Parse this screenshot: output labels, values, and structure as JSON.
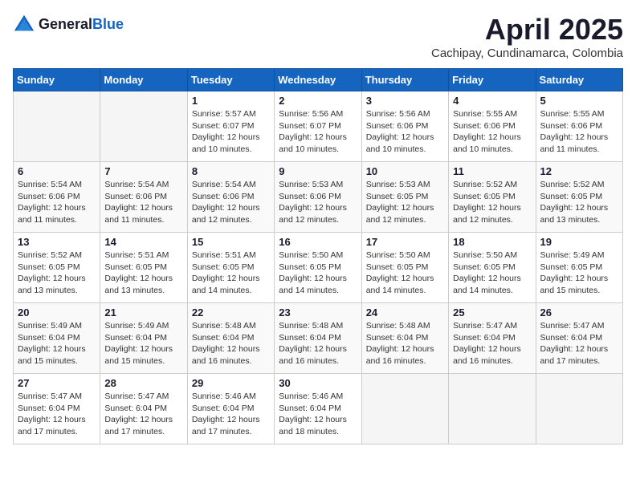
{
  "header": {
    "logo_general": "General",
    "logo_blue": "Blue",
    "month_year": "April 2025",
    "location": "Cachipay, Cundinamarca, Colombia"
  },
  "calendar": {
    "weekdays": [
      "Sunday",
      "Monday",
      "Tuesday",
      "Wednesday",
      "Thursday",
      "Friday",
      "Saturday"
    ],
    "weeks": [
      [
        {
          "day": "",
          "sunrise": "",
          "sunset": "",
          "daylight": ""
        },
        {
          "day": "",
          "sunrise": "",
          "sunset": "",
          "daylight": ""
        },
        {
          "day": "1",
          "sunrise": "Sunrise: 5:57 AM",
          "sunset": "Sunset: 6:07 PM",
          "daylight": "Daylight: 12 hours and 10 minutes."
        },
        {
          "day": "2",
          "sunrise": "Sunrise: 5:56 AM",
          "sunset": "Sunset: 6:07 PM",
          "daylight": "Daylight: 12 hours and 10 minutes."
        },
        {
          "day": "3",
          "sunrise": "Sunrise: 5:56 AM",
          "sunset": "Sunset: 6:06 PM",
          "daylight": "Daylight: 12 hours and 10 minutes."
        },
        {
          "day": "4",
          "sunrise": "Sunrise: 5:55 AM",
          "sunset": "Sunset: 6:06 PM",
          "daylight": "Daylight: 12 hours and 10 minutes."
        },
        {
          "day": "5",
          "sunrise": "Sunrise: 5:55 AM",
          "sunset": "Sunset: 6:06 PM",
          "daylight": "Daylight: 12 hours and 11 minutes."
        }
      ],
      [
        {
          "day": "6",
          "sunrise": "Sunrise: 5:54 AM",
          "sunset": "Sunset: 6:06 PM",
          "daylight": "Daylight: 12 hours and 11 minutes."
        },
        {
          "day": "7",
          "sunrise": "Sunrise: 5:54 AM",
          "sunset": "Sunset: 6:06 PM",
          "daylight": "Daylight: 12 hours and 11 minutes."
        },
        {
          "day": "8",
          "sunrise": "Sunrise: 5:54 AM",
          "sunset": "Sunset: 6:06 PM",
          "daylight": "Daylight: 12 hours and 12 minutes."
        },
        {
          "day": "9",
          "sunrise": "Sunrise: 5:53 AM",
          "sunset": "Sunset: 6:06 PM",
          "daylight": "Daylight: 12 hours and 12 minutes."
        },
        {
          "day": "10",
          "sunrise": "Sunrise: 5:53 AM",
          "sunset": "Sunset: 6:05 PM",
          "daylight": "Daylight: 12 hours and 12 minutes."
        },
        {
          "day": "11",
          "sunrise": "Sunrise: 5:52 AM",
          "sunset": "Sunset: 6:05 PM",
          "daylight": "Daylight: 12 hours and 12 minutes."
        },
        {
          "day": "12",
          "sunrise": "Sunrise: 5:52 AM",
          "sunset": "Sunset: 6:05 PM",
          "daylight": "Daylight: 12 hours and 13 minutes."
        }
      ],
      [
        {
          "day": "13",
          "sunrise": "Sunrise: 5:52 AM",
          "sunset": "Sunset: 6:05 PM",
          "daylight": "Daylight: 12 hours and 13 minutes."
        },
        {
          "day": "14",
          "sunrise": "Sunrise: 5:51 AM",
          "sunset": "Sunset: 6:05 PM",
          "daylight": "Daylight: 12 hours and 13 minutes."
        },
        {
          "day": "15",
          "sunrise": "Sunrise: 5:51 AM",
          "sunset": "Sunset: 6:05 PM",
          "daylight": "Daylight: 12 hours and 14 minutes."
        },
        {
          "day": "16",
          "sunrise": "Sunrise: 5:50 AM",
          "sunset": "Sunset: 6:05 PM",
          "daylight": "Daylight: 12 hours and 14 minutes."
        },
        {
          "day": "17",
          "sunrise": "Sunrise: 5:50 AM",
          "sunset": "Sunset: 6:05 PM",
          "daylight": "Daylight: 12 hours and 14 minutes."
        },
        {
          "day": "18",
          "sunrise": "Sunrise: 5:50 AM",
          "sunset": "Sunset: 6:05 PM",
          "daylight": "Daylight: 12 hours and 14 minutes."
        },
        {
          "day": "19",
          "sunrise": "Sunrise: 5:49 AM",
          "sunset": "Sunset: 6:05 PM",
          "daylight": "Daylight: 12 hours and 15 minutes."
        }
      ],
      [
        {
          "day": "20",
          "sunrise": "Sunrise: 5:49 AM",
          "sunset": "Sunset: 6:04 PM",
          "daylight": "Daylight: 12 hours and 15 minutes."
        },
        {
          "day": "21",
          "sunrise": "Sunrise: 5:49 AM",
          "sunset": "Sunset: 6:04 PM",
          "daylight": "Daylight: 12 hours and 15 minutes."
        },
        {
          "day": "22",
          "sunrise": "Sunrise: 5:48 AM",
          "sunset": "Sunset: 6:04 PM",
          "daylight": "Daylight: 12 hours and 16 minutes."
        },
        {
          "day": "23",
          "sunrise": "Sunrise: 5:48 AM",
          "sunset": "Sunset: 6:04 PM",
          "daylight": "Daylight: 12 hours and 16 minutes."
        },
        {
          "day": "24",
          "sunrise": "Sunrise: 5:48 AM",
          "sunset": "Sunset: 6:04 PM",
          "daylight": "Daylight: 12 hours and 16 minutes."
        },
        {
          "day": "25",
          "sunrise": "Sunrise: 5:47 AM",
          "sunset": "Sunset: 6:04 PM",
          "daylight": "Daylight: 12 hours and 16 minutes."
        },
        {
          "day": "26",
          "sunrise": "Sunrise: 5:47 AM",
          "sunset": "Sunset: 6:04 PM",
          "daylight": "Daylight: 12 hours and 17 minutes."
        }
      ],
      [
        {
          "day": "27",
          "sunrise": "Sunrise: 5:47 AM",
          "sunset": "Sunset: 6:04 PM",
          "daylight": "Daylight: 12 hours and 17 minutes."
        },
        {
          "day": "28",
          "sunrise": "Sunrise: 5:47 AM",
          "sunset": "Sunset: 6:04 PM",
          "daylight": "Daylight: 12 hours and 17 minutes."
        },
        {
          "day": "29",
          "sunrise": "Sunrise: 5:46 AM",
          "sunset": "Sunset: 6:04 PM",
          "daylight": "Daylight: 12 hours and 17 minutes."
        },
        {
          "day": "30",
          "sunrise": "Sunrise: 5:46 AM",
          "sunset": "Sunset: 6:04 PM",
          "daylight": "Daylight: 12 hours and 18 minutes."
        },
        {
          "day": "",
          "sunrise": "",
          "sunset": "",
          "daylight": ""
        },
        {
          "day": "",
          "sunrise": "",
          "sunset": "",
          "daylight": ""
        },
        {
          "day": "",
          "sunrise": "",
          "sunset": "",
          "daylight": ""
        }
      ]
    ]
  }
}
